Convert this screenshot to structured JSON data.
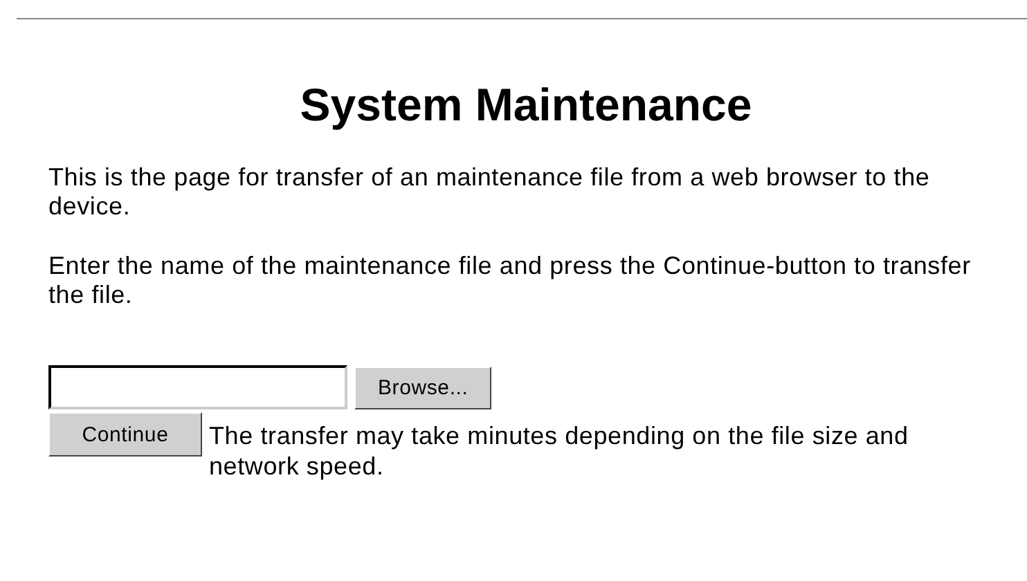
{
  "title": "System Maintenance",
  "paragraphs": [
    "This is the page for transfer of an maintenance file from a web browser to the device.",
    "Enter the name of the maintenance file and press the Continue-button to transfer the file."
  ],
  "file_field": {
    "browse_button": "Browse..."
  },
  "continue_button": "Continue",
  "note": "The transfer may take minutes depending on the file size and network speed."
}
